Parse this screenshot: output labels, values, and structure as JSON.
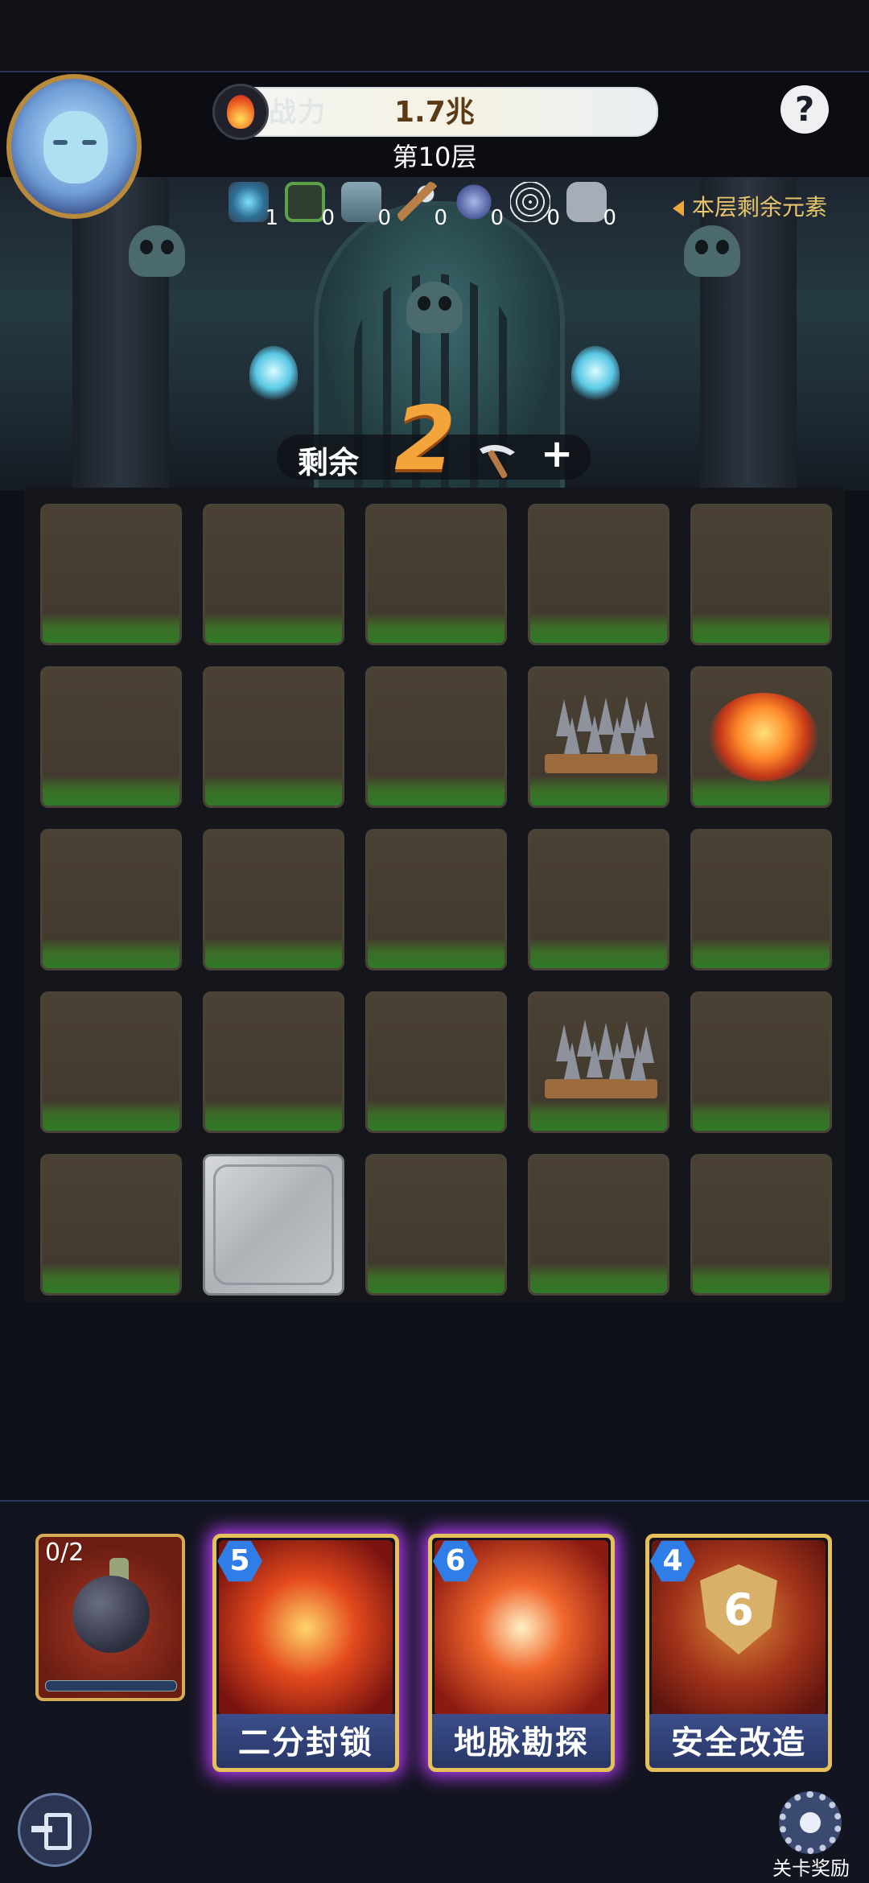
{
  "header": {
    "power_label": "战力",
    "power_value": "1.7兆",
    "help_icon": "?",
    "floor_label": "第10层"
  },
  "elements": [
    {
      "icon": "portal-icon",
      "count": "1"
    },
    {
      "icon": "forbidden-icon",
      "count": "0"
    },
    {
      "icon": "locked-gate-icon",
      "count": "0"
    },
    {
      "icon": "pickaxe-icon",
      "count": "0"
    },
    {
      "icon": "crossed-swords-icon",
      "count": "0"
    },
    {
      "icon": "spider-web-icon",
      "count": "0"
    },
    {
      "icon": "puzzle-piece-icon",
      "count": "0"
    }
  ],
  "remaining_elements_label": "本层剩余元素",
  "dig": {
    "label": "剩余",
    "remaining": "2",
    "plus": "+"
  },
  "board": {
    "rows": 5,
    "cols": 5,
    "tiles": [
      [
        "dirt",
        "dirt",
        "dirt",
        "dirt",
        "dirt"
      ],
      [
        "dirt",
        "dirt",
        "dirt",
        "spike-trap",
        "lava-pit"
      ],
      [
        "dirt",
        "dirt",
        "dirt",
        "dirt",
        "dirt"
      ],
      [
        "dirt",
        "dirt",
        "dirt",
        "spike-trap",
        "dirt"
      ],
      [
        "dirt",
        "stone",
        "dirt",
        "dirt",
        "dirt"
      ]
    ]
  },
  "skills": {
    "bomb": {
      "count": "0/2"
    },
    "cards": [
      {
        "cost": "5",
        "name": "二分封锁",
        "glow": true
      },
      {
        "cost": "6",
        "name": "地脉勘探",
        "glow": true
      },
      {
        "cost": "4",
        "name": "安全改造",
        "glow": false,
        "badge": "6"
      }
    ]
  },
  "footer": {
    "reward_label": "关卡奖励"
  },
  "colors": {
    "accent_gold": "#e8c56a",
    "card_glow": "#b43cf3",
    "cost_blue": "#2f7de6",
    "remaining_orange": "#f3a43a"
  }
}
